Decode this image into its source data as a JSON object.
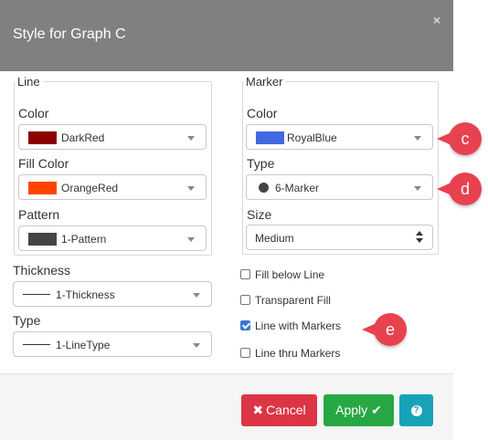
{
  "dialog": {
    "title": "Style for Graph C",
    "close_glyph": "×"
  },
  "line_group": {
    "legend": "Line",
    "color": {
      "label": "Color",
      "value": "DarkRed",
      "swatch": "#8b0000"
    },
    "fill_color": {
      "label": "Fill Color",
      "value": "OrangeRed",
      "swatch": "#ff4500"
    },
    "pattern": {
      "label": "Pattern",
      "value": "1-Pattern",
      "swatch": "#454545"
    }
  },
  "thickness": {
    "label": "Thickness",
    "value": "1-Thickness"
  },
  "type": {
    "label": "Type",
    "value": "1-LineType"
  },
  "marker_group": {
    "legend": "Marker",
    "color": {
      "label": "Color",
      "value": "RoyalBlue",
      "swatch": "#4169e1"
    },
    "type": {
      "label": "Type",
      "value": "6-Marker"
    },
    "size": {
      "label": "Size",
      "value": "Medium"
    }
  },
  "checkboxes": [
    {
      "label": "Fill below Line",
      "checked": false
    },
    {
      "label": "Transparent Fill",
      "checked": false
    },
    {
      "label": "Line with Markers",
      "checked": true
    },
    {
      "label": "Line thru Markers",
      "checked": false
    }
  ],
  "buttons": {
    "cancel": "Cancel",
    "apply": "Apply",
    "help_glyph": "?"
  },
  "callouts": {
    "c": "c",
    "d": "d",
    "e": "e"
  },
  "colors": {
    "header": "#808080",
    "cancel": "#dc3545",
    "apply": "#28a745",
    "help": "#17a2b8",
    "callout": "#e8414f"
  }
}
